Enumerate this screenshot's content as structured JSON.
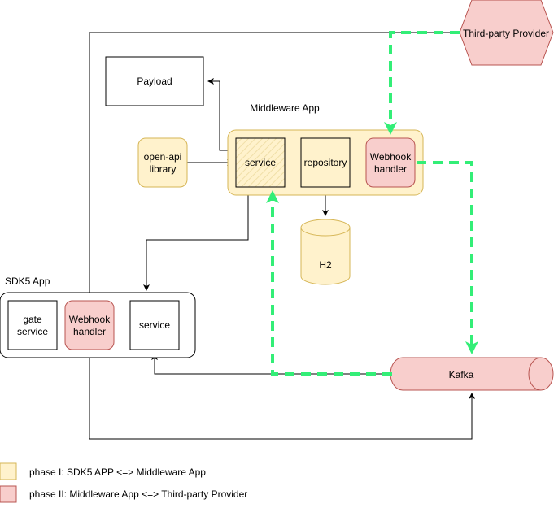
{
  "diagram": {
    "nodes": {
      "payload": "Payload",
      "middleware_title": "Middleware App",
      "openapi_line1": "open-api",
      "openapi_line2": "library",
      "mw_service": "service",
      "mw_repository": "repository",
      "mw_webhook_line1": "Webhook",
      "mw_webhook_line2": "handler",
      "h2": "H2",
      "third_party": "Third-party Provider",
      "sdk5_title": "SDK5 App",
      "gate_line1": "gate",
      "gate_line2": "service",
      "sdk_webhook_line1": "Webhook",
      "sdk_webhook_line2": "handler",
      "sdk_service": "service",
      "kafka": "Kafka"
    },
    "legend": [
      {
        "label": "phase I: SDK5 APP <=> Middleware App",
        "color": "#fff2cc"
      },
      {
        "label": "phase II: Middleware App <=> Third-party Provider",
        "color": "#f8cecc"
      }
    ],
    "colors": {
      "phase1_fill": "#fff2cc",
      "phase1_stroke": "#d6b656",
      "phase2_fill": "#f8cecc",
      "phase2_stroke": "#b85450",
      "flow_green": "#33ee77"
    }
  }
}
